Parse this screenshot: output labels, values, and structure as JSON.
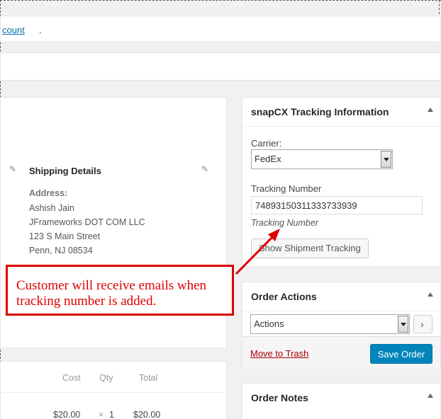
{
  "notice": {
    "link_text": "count",
    "after_text": "."
  },
  "shipping": {
    "title": "Shipping Details",
    "address_label": "Address:",
    "address_lines": [
      "Ashish Jain",
      "JFrameworks DOT COM LLC",
      "123 S Main Street",
      "Penn, NJ 08534"
    ]
  },
  "items_table": {
    "headers": {
      "cost": "Cost",
      "qty": "Qty",
      "total": "Total"
    },
    "row": {
      "cost": "$20.00",
      "qty_x": "×",
      "qty": "1",
      "total": "$20.00"
    }
  },
  "tracking": {
    "title": "snapCX Tracking Information",
    "carrier_label": "Carrier:",
    "carrier_value": "FedEx",
    "number_label": "Tracking Number",
    "number_value": "74893150311333733939",
    "number_hint": "Tracking Number",
    "show_button": "Show Shipment Tracking"
  },
  "order_actions": {
    "title": "Order Actions",
    "select_value": "Actions",
    "trash_link": "Move to Trash",
    "save_button": "Save Order"
  },
  "order_notes": {
    "title": "Order Notes"
  },
  "callout": {
    "text": "Customer will receive emails when tracking number is added."
  },
  "colors": {
    "accent": "#0085ba",
    "link": "#0073aa",
    "trash": "#a00",
    "callout": "#dd0000"
  }
}
